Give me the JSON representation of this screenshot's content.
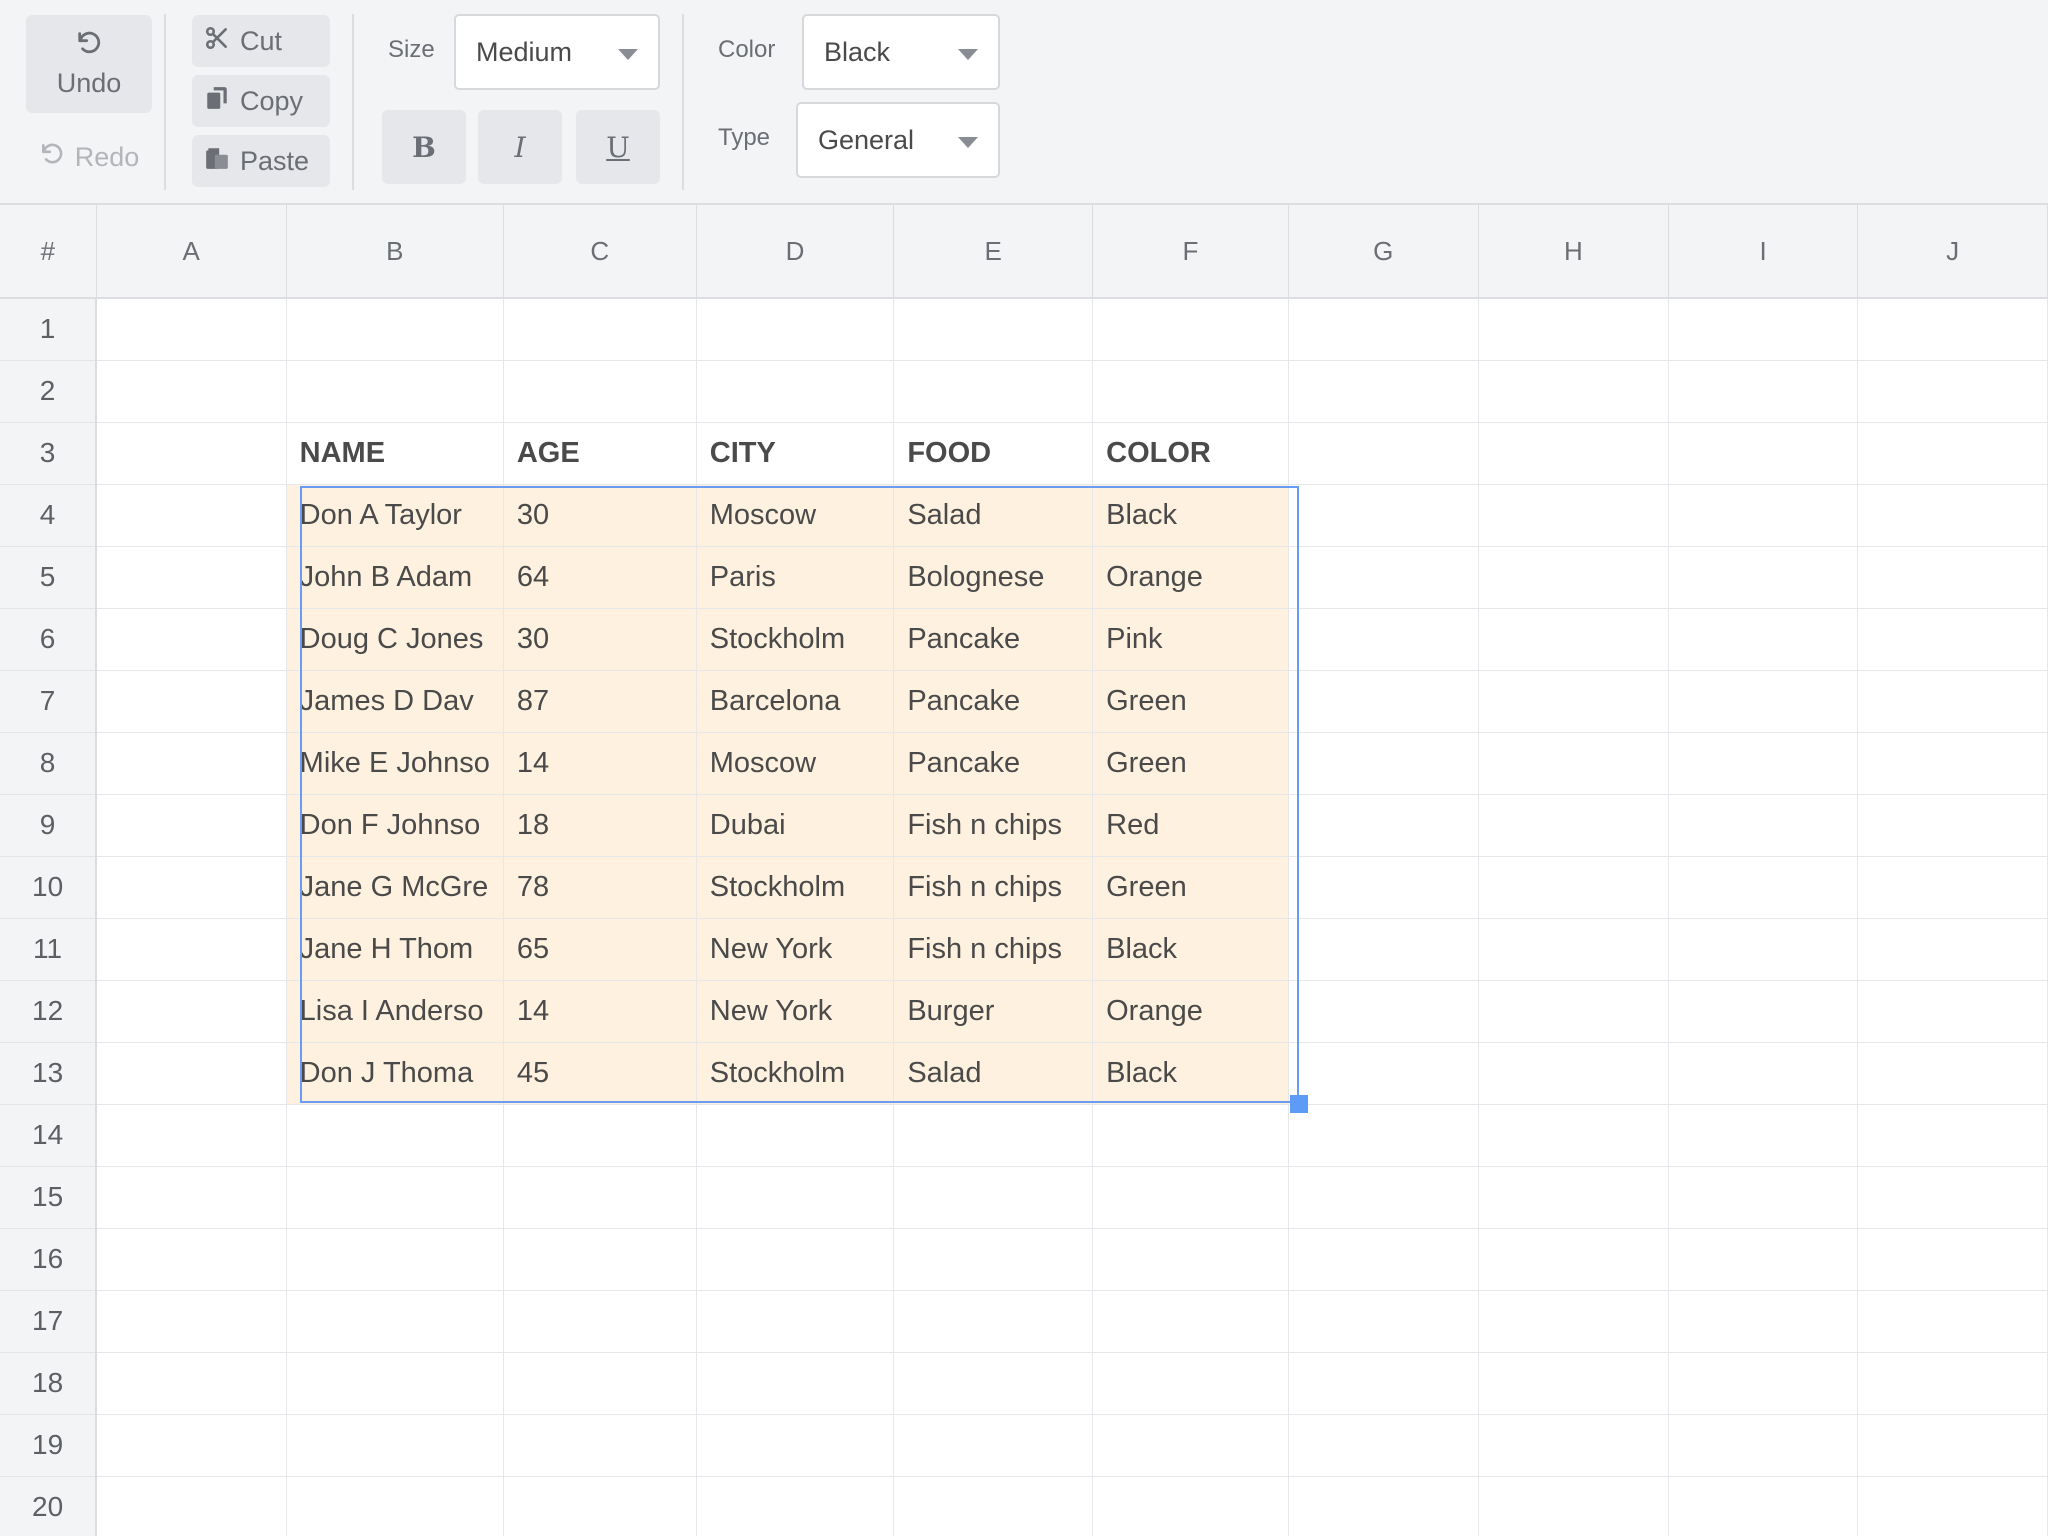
{
  "toolbar": {
    "undo_label": "Undo",
    "redo_label": "Redo",
    "cut_label": "Cut",
    "copy_label": "Copy",
    "paste_label": "Paste",
    "size_label": "Size",
    "size_value": "Medium",
    "color_label": "Color",
    "color_value": "Black",
    "type_label": "Type",
    "type_value": "General",
    "bold_label": "B",
    "italic_label": "I",
    "underline_label": "U",
    "icons": [
      "undo-icon",
      "redo-icon",
      "scissors-icon",
      "copy-icon",
      "paste-icon",
      "chevron-down-icon"
    ]
  },
  "grid": {
    "corner": "#",
    "columns": [
      "A",
      "B",
      "C",
      "D",
      "E",
      "F",
      "G",
      "H",
      "I",
      "J"
    ],
    "row_numbers": [
      "1",
      "2",
      "3",
      "4",
      "5",
      "6",
      "7",
      "8",
      "9",
      "10",
      "11",
      "12",
      "13",
      "14",
      "15",
      "16",
      "17",
      "18",
      "19",
      "20"
    ],
    "table_header_row": 3,
    "headers": [
      "NAME",
      "AGE",
      "CITY",
      "FOOD",
      "COLOR"
    ],
    "records": [
      [
        "Don A Taylor",
        "30",
        "Moscow",
        "Salad",
        "Black"
      ],
      [
        "John B Adam",
        "64",
        "Paris",
        "Bolognese",
        "Orange"
      ],
      [
        "Doug C Jones",
        "30",
        "Stockholm",
        "Pancake",
        "Pink"
      ],
      [
        "James D Dav",
        "87",
        "Barcelona",
        "Pancake",
        "Green"
      ],
      [
        "Mike E Johnso",
        "14",
        "Moscow",
        "Pancake",
        "Green"
      ],
      [
        "Don F Johnso",
        "18",
        "Dubai",
        "Fish n chips",
        "Red"
      ],
      [
        "Jane G McGre",
        "78",
        "Stockholm",
        "Fish n chips",
        "Green"
      ],
      [
        "Jane H Thom",
        "65",
        "New York",
        "Fish n chips",
        "Black"
      ],
      [
        "Lisa I Anderso",
        "14",
        "New York",
        "Burger",
        "Orange"
      ],
      [
        "Don J Thoma",
        "45",
        "Stockholm",
        "Salad",
        "Black"
      ]
    ],
    "selected_range": "B4:F13",
    "colors": {
      "selection_fill": "#fef1e0",
      "selection_border": "#6a9cf5",
      "header_bg": "#f3f4f6"
    }
  }
}
